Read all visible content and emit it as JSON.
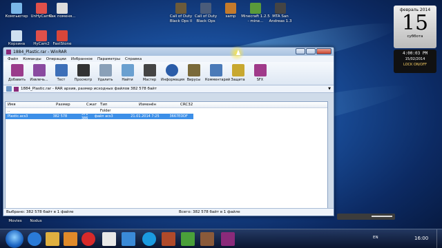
{
  "desktop": {
    "icons": [
      {
        "id": "computer",
        "label": "Компьютер",
        "color": "#7ab7e8"
      },
      {
        "id": "unhycam2",
        "label": "UnHyCam2",
        "color": "#e0504a"
      },
      {
        "id": "kak",
        "label": "Как поменя...",
        "color": "#dddddd"
      },
      {
        "id": "cod-bo2",
        "label": "Call of Duty Black Ops II",
        "color": "#6b5a3a"
      },
      {
        "id": "cod-bo",
        "label": "Call of Duty Black Ops",
        "color": "#4a5c7a"
      },
      {
        "id": "samp",
        "label": "samp",
        "color": "#c47a2b"
      },
      {
        "id": "minecraft",
        "label": "Minecraft 1.2.5 - mine...",
        "color": "#5a9a3a"
      },
      {
        "id": "mta",
        "label": "MTA San Andreas 1.3",
        "color": "#444444"
      },
      {
        "id": "recycle",
        "label": "Корзина",
        "color": "#cfe0f0"
      },
      {
        "id": "hycam2",
        "label": "HyCam2",
        "color": "#e0504a"
      },
      {
        "id": "faststone",
        "label": "FastStone",
        "color": "#d8463a"
      },
      {
        "id": "movies",
        "label": "Movies",
        "color": ""
      },
      {
        "id": "nodus",
        "label": "Nodus",
        "color": ""
      }
    ]
  },
  "window": {
    "title": "1884_Plastic.rar - WinRAR",
    "menu": [
      "Файл",
      "Команды",
      "Операции",
      "Избранное",
      "Параметры",
      "Справка"
    ],
    "toolbar": [
      {
        "label": "Добавить",
        "icon": "books-add-icon",
        "color": "#9a3b8b"
      },
      {
        "label": "Извлечь...",
        "icon": "books-extract-icon",
        "color": "#8a4aa0"
      },
      {
        "label": "Тест",
        "icon": "checklist-icon",
        "color": "#3d6fb8"
      },
      {
        "label": "Просмотр",
        "icon": "binoculars-icon",
        "color": "#333333"
      },
      {
        "label": "Удалить",
        "icon": "trash-icon",
        "color": "#8aa0b8"
      },
      {
        "label": "Найти",
        "icon": "magnifier-icon",
        "color": "#6aa0d0"
      },
      {
        "label": "Мастер",
        "icon": "wizard-hat-icon",
        "color": "#444444"
      },
      {
        "label": "Информация",
        "icon": "info-icon",
        "color": "#2a5ca8"
      },
      {
        "label": "Вирусы",
        "icon": "snake-icon",
        "color": "#7a6a3a"
      },
      {
        "label": "Комментарий",
        "icon": "comment-icon",
        "color": "#4a7ab8"
      },
      {
        "label": "Защита",
        "icon": "shield-icon",
        "color": "#c8a830"
      },
      {
        "label": "SFX",
        "icon": "sfx-icon",
        "color": "#a03a8a"
      }
    ],
    "path": "1884_Plastic.rar - RAR архив, размер исходных файлов 382 578 байт",
    "columns": {
      "name": "Имя",
      "size": "Размер",
      "packed": "Сжат",
      "type": "Тип",
      "modified": "Изменён",
      "crc": "CRC32"
    },
    "rows": [
      {
        "name": "..",
        "size": "",
        "packed": "",
        "type": "Folder",
        "modified": "",
        "crc": ""
      },
      {
        "name": "Plastic.acs3",
        "size": "382 578",
        "packed": "371 386",
        "type": "файл acs3",
        "modified": "21.01.2014 7:25",
        "crc": "3667EDDF"
      }
    ],
    "status_left": "Выбрано: 382 578 байт в 1 файле",
    "status_right": "Всего: 382 578 байт в 1 файле"
  },
  "gadgets": {
    "calendar": {
      "month": "февраль 2014",
      "day": "15",
      "weekday": "суббота"
    },
    "clock": {
      "time": "4:00:03 PM",
      "date": "15/02/2014",
      "lock": "LOCK ON/OFF"
    }
  },
  "taskbar": {
    "items": [
      {
        "icon": "ie-icon",
        "color": "#2a7ad8"
      },
      {
        "icon": "explorer-icon",
        "color": "#e0b040"
      },
      {
        "icon": "media-icon",
        "color": "#e08a2a"
      },
      {
        "icon": "opera-icon",
        "color": "#d82a2a"
      },
      {
        "icon": "yandex-icon",
        "color": "#e8e8e8"
      },
      {
        "icon": "chat-icon",
        "color": "#3a8ad8"
      },
      {
        "icon": "skype-icon",
        "color": "#1a9ae0"
      },
      {
        "icon": "game-icon",
        "color": "#b04a2a"
      },
      {
        "icon": "app-icon",
        "color": "#4aa03a"
      },
      {
        "icon": "app2-icon",
        "color": "#8a5a3a"
      },
      {
        "icon": "winrar-icon",
        "color": "#8a2a7a"
      }
    ],
    "lang": "EN",
    "time": "16:00"
  }
}
